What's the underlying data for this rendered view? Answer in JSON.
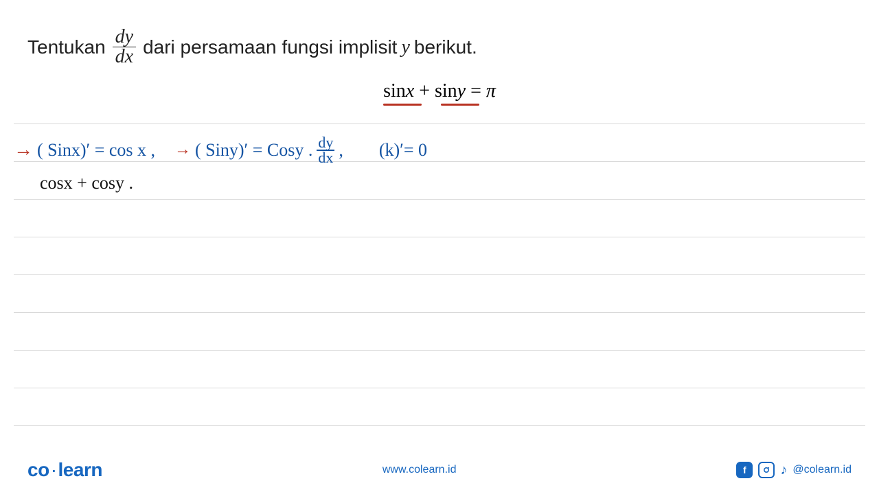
{
  "question": {
    "prefix": "Tentukan",
    "frac_num": "dy",
    "frac_den": "dx",
    "suffix1": "dari persamaan fungsi implisit",
    "var": "y",
    "suffix2": "berikut."
  },
  "equation": {
    "part1": "sin",
    "x": "x",
    "plus": " + ",
    "part2": "sin",
    "y": "y",
    "eq": " = ",
    "pi": "π"
  },
  "handwriting": {
    "line1_a": "( Sinx)′ = cos x ,",
    "line1_b": "( Siny)′ = Cosy .",
    "line1_frac_n": "dy",
    "line1_frac_d": "dx",
    "line1_comma": ",",
    "line1_c": "(k)′= 0",
    "line2": "cosx + cosy ."
  },
  "footer": {
    "logo_a": "co",
    "logo_b": "learn",
    "url": "www.colearn.id",
    "handle": "@colearn.id"
  }
}
